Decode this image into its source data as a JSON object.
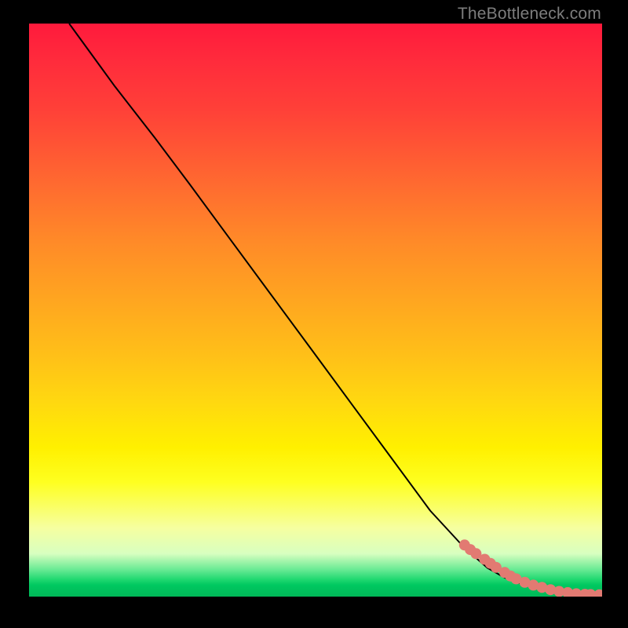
{
  "attribution": "TheBottleneck.com",
  "chart_data": {
    "type": "line",
    "title": "",
    "xlabel": "",
    "ylabel": "",
    "xlim": [
      0,
      100
    ],
    "ylim": [
      0,
      100
    ],
    "grid": false,
    "legend": false,
    "background": "gradient red→yellow→green (top→bottom)",
    "series": [
      {
        "name": "curve",
        "style": "line",
        "color": "#000000",
        "x": [
          7,
          15,
          22,
          28,
          35,
          42,
          49,
          56,
          63,
          70,
          76,
          80,
          83,
          86,
          89,
          92,
          95,
          99.5
        ],
        "y": [
          100,
          89,
          80,
          72,
          62.5,
          53,
          43.5,
          34,
          24.5,
          15,
          8.5,
          5,
          3.3,
          2.2,
          1.4,
          0.9,
          0.5,
          0.3
        ]
      },
      {
        "name": "markers",
        "style": "scatter",
        "color": "#e27a72",
        "x": [
          76,
          77,
          78,
          79.5,
          80.5,
          81.5,
          83,
          84,
          85,
          86.5,
          88,
          89.5,
          91,
          92.5,
          94,
          95.5,
          97,
          98,
          99.5
        ],
        "y": [
          9,
          8.2,
          7.5,
          6.5,
          5.8,
          5.1,
          4.2,
          3.6,
          3.1,
          2.5,
          2.0,
          1.6,
          1.2,
          0.9,
          0.7,
          0.5,
          0.4,
          0.35,
          0.3
        ]
      }
    ]
  }
}
